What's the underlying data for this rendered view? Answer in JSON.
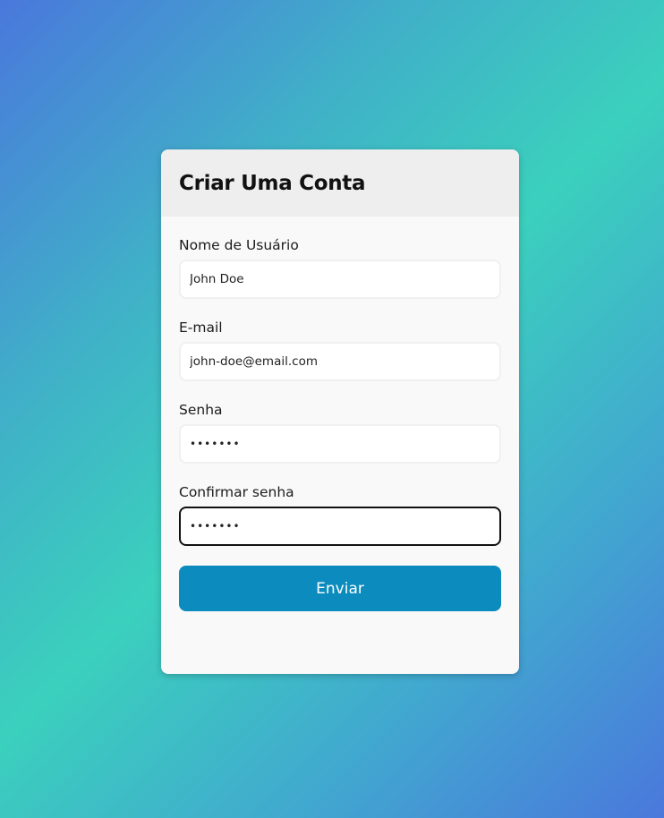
{
  "form": {
    "title": "Criar Uma Conta",
    "fields": [
      {
        "label": "Nome de Usuário",
        "value": "John Doe",
        "type": "text"
      },
      {
        "label": "E-mail",
        "value": "john-doe@email.com",
        "type": "email"
      },
      {
        "label": "Senha",
        "value": "•••••••",
        "type": "password"
      },
      {
        "label": "Confirmar senha",
        "value": "•••••••",
        "type": "password",
        "focused": true
      }
    ],
    "submit_label": "Enviar"
  },
  "colors": {
    "gradient_start": "#4a78dc",
    "gradient_mid": "#3bd0bd",
    "card_background": "#f9f9f9",
    "header_background": "#eeeeee",
    "button_background": "#0b8bbe",
    "button_text": "#ffffff",
    "focused_border": "#111111"
  }
}
